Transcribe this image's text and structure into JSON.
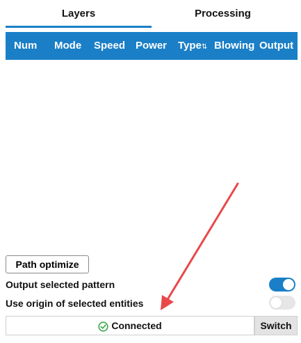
{
  "tabs": [
    {
      "label": "Layers",
      "active": true
    },
    {
      "label": "Processing",
      "active": false
    }
  ],
  "table": {
    "columns": [
      "Num",
      "Mode",
      "Speed",
      "Power",
      "Type",
      "Blowing",
      "Output"
    ],
    "type_sort_glyph": "⇅",
    "rows": []
  },
  "path_optimize_label": "Path optimize",
  "options": {
    "output_selected_label": "Output selected pattern",
    "output_selected_on": true,
    "use_origin_label": "Use origin of selected entities",
    "use_origin_on": false
  },
  "status": {
    "text": "Connected",
    "icon": "check-circle-icon",
    "switch_label": "Switch"
  },
  "colors": {
    "accent": "#1a7fc7",
    "status_ok": "#3aa64a",
    "annotation_arrow": "#e9484b"
  }
}
